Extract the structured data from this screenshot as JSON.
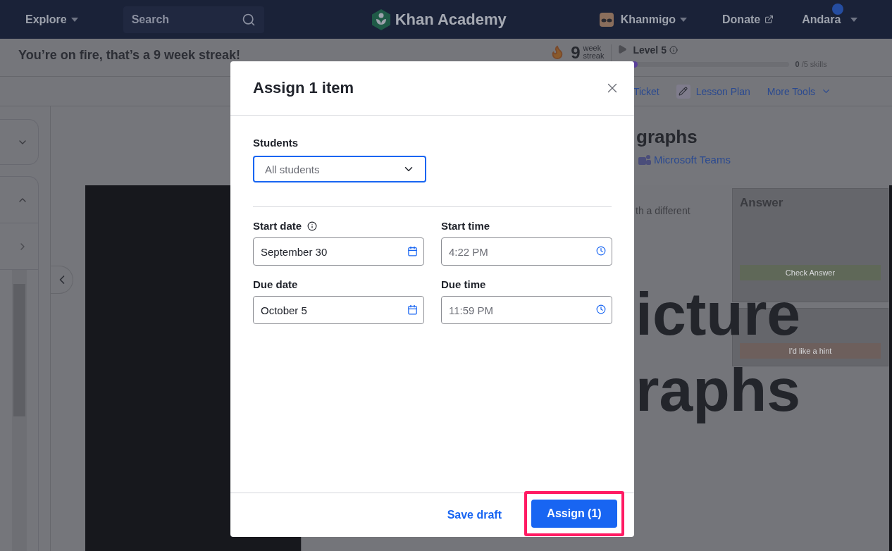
{
  "header": {
    "explore": "Explore",
    "search_placeholder": "Search",
    "logo": "Khan Academy",
    "khanmigo": "Khanmigo",
    "donate": "Donate",
    "user": "Andara"
  },
  "streak_bar": {
    "message": "You’re on fire, that’s a 9 week streak!",
    "count": "9",
    "unit_top": "week",
    "unit_bottom": "streak",
    "level_label": "Level 5",
    "progress": {
      "level": 0
    },
    "skills_done": "0",
    "skills_total": "/5 skills"
  },
  "tools": [
    {
      "label": "Ticket",
      "kind": "link"
    },
    {
      "label": "Lesson Plan",
      "kind": "pencil"
    },
    {
      "label": "More Tools",
      "kind": "menu"
    }
  ],
  "content": {
    "title": "graphs",
    "share_link": "Microsoft Teams"
  },
  "video": {
    "prompt": "th a different",
    "big_text": [
      "icture",
      "raphs"
    ],
    "panel": {
      "heading": "Answer",
      "check_button": "Check Answer",
      "hint_button": "I'd like a hint"
    }
  },
  "modal": {
    "title": "Assign 1 item",
    "students_label": "Students",
    "students_value": "All students",
    "fields": [
      {
        "label": "Start date",
        "info": true,
        "kind": "date",
        "value": "September 30"
      },
      {
        "label": "Start time",
        "info": false,
        "kind": "time",
        "placeholder": "4:22 PM"
      },
      {
        "label": "Due date",
        "info": false,
        "kind": "date",
        "value": "October 5"
      },
      {
        "label": "Due time",
        "info": false,
        "kind": "time",
        "placeholder": "11:59 PM"
      }
    ],
    "save_draft": "Save draft",
    "assign_button": "Assign (1)",
    "assign_highlighted": true
  }
}
